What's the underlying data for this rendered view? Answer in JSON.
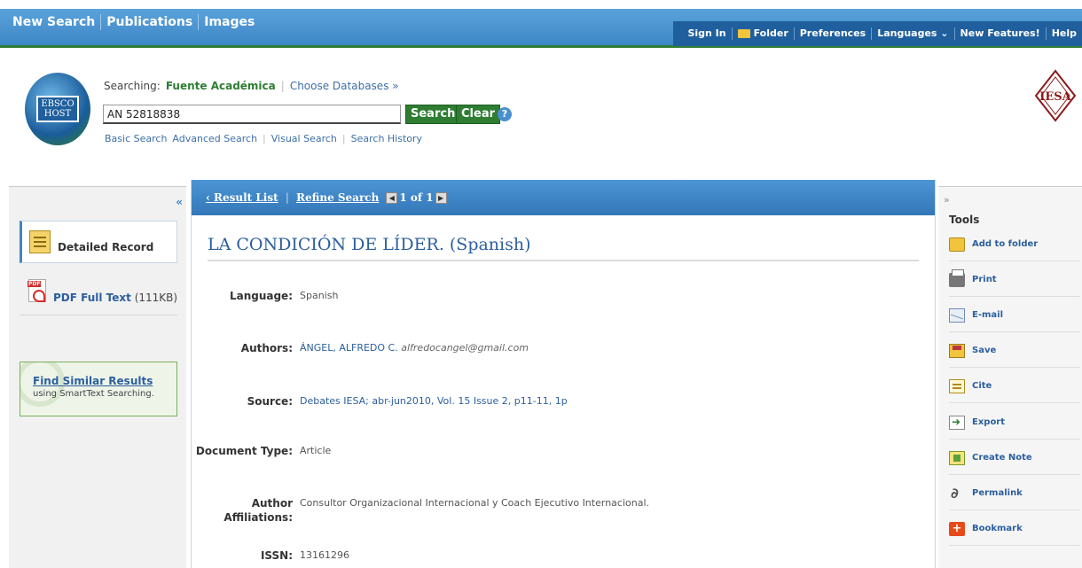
{
  "topnav": {
    "items": [
      "New Search",
      "Publications",
      "Images"
    ]
  },
  "utilbar": {
    "items": [
      "Sign In",
      "Folder",
      "Preferences",
      "Languages ⌄",
      "New Features!",
      "Help"
    ]
  },
  "logo": {
    "line1": "EBSCO",
    "line2": "HOST"
  },
  "search": {
    "searching_label": "Searching:",
    "database": "Fuente Académica",
    "choose_databases": "Choose Databases »",
    "query": "AN 52818838",
    "search_button": "Search",
    "clear_button": "Clear",
    "help": "?",
    "links": [
      "Basic Search",
      "Advanced Search",
      "Visual Search",
      "Search History"
    ]
  },
  "publisher_logo": "IESA",
  "left": {
    "collapse": "«",
    "detailed_record": "Detailed Record",
    "pdf_label": "PDF Full Text",
    "pdf_size": "(111KB)",
    "find_similar": "Find Similar Results",
    "find_similar_sub": "using SmartText Searching."
  },
  "main": {
    "result_list": "‹ Result List",
    "refine_search": "Refine Search",
    "pager": "1 of 1",
    "title": "LA CONDICIÓN DE LÍDER. (Spanish)",
    "fields": [
      {
        "label": "Language:",
        "value": "Spanish"
      },
      {
        "label": "Authors:",
        "value": "ÁNGEL, ALFREDO C.",
        "email": "alfredocangel@gmail.com"
      },
      {
        "label": "Source:",
        "value": "Debates IESA; abr-jun2010, Vol. 15 Issue 2, p11-11, 1p"
      },
      {
        "label": "Document Type:",
        "value": "Article"
      },
      {
        "label": "Author Affiliations:",
        "value": "Consultor Organizacional Internacional y Coach Ejecutivo Internacional."
      },
      {
        "label": "ISSN:",
        "value": "13161296"
      }
    ]
  },
  "right": {
    "collapse": "»",
    "tools_title": "Tools",
    "tools": [
      {
        "label": "Add to folder",
        "icon": "folder-icon"
      },
      {
        "label": "Print",
        "icon": "print-icon"
      },
      {
        "label": "E-mail",
        "icon": "email-icon"
      },
      {
        "label": "Save",
        "icon": "save-icon"
      },
      {
        "label": "Cite",
        "icon": "cite-icon"
      },
      {
        "label": "Export",
        "icon": "export-icon"
      },
      {
        "label": "Create Note",
        "icon": "note-icon"
      },
      {
        "label": "Permalink",
        "icon": "permalink-icon"
      },
      {
        "label": "Bookmark",
        "icon": "bookmark-icon"
      }
    ]
  }
}
